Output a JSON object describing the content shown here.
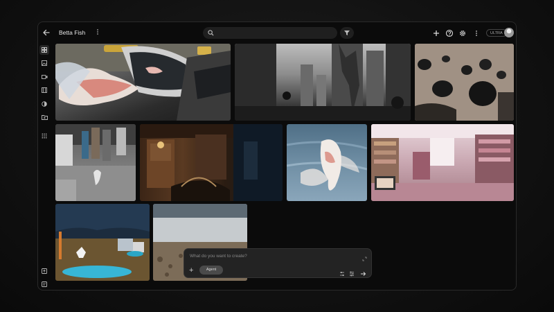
{
  "header": {
    "project_title": "Betta Fish",
    "plan_badge": "ULTRA"
  },
  "icons": {
    "back": "back-arrow-icon",
    "search": "search-icon",
    "filter": "filter-icon",
    "add": "plus-icon",
    "help": "help-icon",
    "settings": "gear-icon",
    "more": "more-vertical-icon"
  },
  "sidebar": {
    "items": [
      {
        "icon": "grid-view-icon",
        "active": true
      },
      {
        "icon": "image-icon",
        "active": false
      },
      {
        "icon": "video-icon",
        "active": false
      },
      {
        "icon": "film-icon",
        "active": false
      },
      {
        "icon": "circle-icon",
        "active": false
      },
      {
        "icon": "folder-video-icon",
        "active": false
      },
      {
        "icon": "apps-grid-icon",
        "active": false
      }
    ],
    "bottom": [
      {
        "icon": "upload-icon"
      },
      {
        "icon": "document-icon"
      }
    ]
  },
  "gallery": {
    "tiles": [
      {
        "subject": "betta fish beside car side mirror"
      },
      {
        "subject": "city street with giant mechanical figure"
      },
      {
        "subject": "floating rocks in sky"
      },
      {
        "subject": "rainy street with betta fish"
      },
      {
        "subject": "wood paneled interior with betta fish"
      },
      {
        "subject": "white betta fish in blue water"
      },
      {
        "subject": "pink bookstore interior"
      },
      {
        "subject": "toy animals by blue pond"
      },
      {
        "subject": "rocky landscape"
      }
    ]
  },
  "composer": {
    "placeholder": "What do you want to create?",
    "mode_label": "Agent"
  },
  "colors": {
    "background": "#111111",
    "window": "#0b0b0b",
    "surface": "#232323",
    "accent_chip": "#4a4a4a"
  }
}
